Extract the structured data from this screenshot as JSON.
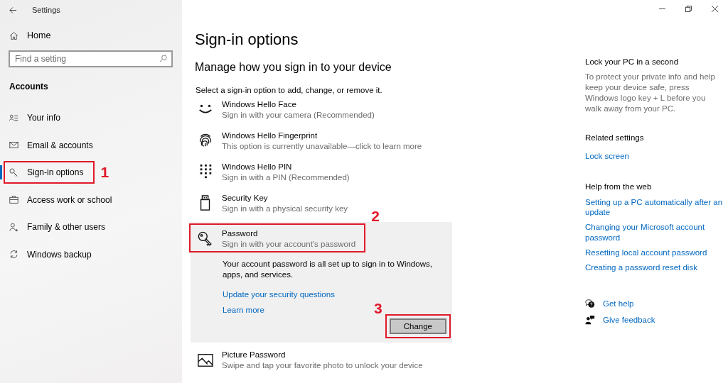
{
  "window": {
    "title": "Settings"
  },
  "sidebar": {
    "home": "Home",
    "search": {
      "placeholder": "Find a setting"
    },
    "section": "Accounts",
    "items": [
      {
        "label": "Your info",
        "kind": "person-list",
        "selected": false
      },
      {
        "label": "Email & accounts",
        "kind": "mail",
        "selected": false
      },
      {
        "label": "Sign-in options",
        "kind": "key",
        "selected": true,
        "callout": "1"
      },
      {
        "label": "Access work or school",
        "kind": "briefcase",
        "selected": false
      },
      {
        "label": "Family & other users",
        "kind": "person-add",
        "selected": false
      },
      {
        "label": "Windows backup",
        "kind": "sync",
        "selected": false
      }
    ]
  },
  "main": {
    "title": "Sign-in options",
    "subtitle": "Manage how you sign in to your device",
    "intro": "Select a sign-in option to add, change, or remove it.",
    "options": [
      {
        "kind": "face",
        "title": "Windows Hello Face",
        "subtitle": "Sign in with your camera (Recommended)",
        "expanded": false
      },
      {
        "kind": "fingerprint",
        "title": "Windows Hello Fingerprint",
        "subtitle": "This option is currently unavailable—click to learn more",
        "expanded": false
      },
      {
        "kind": "pin",
        "title": "Windows Hello PIN",
        "subtitle": "Sign in with a PIN (Recommended)",
        "expanded": false
      },
      {
        "kind": "usb",
        "title": "Security Key",
        "subtitle": "Sign in with a physical security key",
        "expanded": false
      },
      {
        "kind": "key",
        "title": "Password",
        "subtitle": "Sign in with your account's password",
        "expanded": true,
        "callout": "2",
        "details": "Your account password is all set up to sign in to Windows, apps, and services.",
        "links": [
          "Update your security questions",
          "Learn more"
        ],
        "button": {
          "label": "Change",
          "callout": "3"
        }
      },
      {
        "kind": "picture",
        "title": "Picture Password",
        "subtitle": "Swipe and tap your favorite photo to unlock your device",
        "expanded": false
      }
    ]
  },
  "aside": {
    "lock": {
      "title": "Lock your PC in a second",
      "text": "To protect your private info and help keep your device safe, press Windows logo key + L before you walk away from your PC."
    },
    "related": {
      "title": "Related settings",
      "links": [
        "Lock screen"
      ]
    },
    "help": {
      "title": "Help from the web",
      "links": [
        "Setting up a PC automatically after an update",
        "Changing your Microsoft account password",
        "Resetting local account password",
        "Creating a password reset disk"
      ]
    },
    "actions": [
      {
        "kind": "help",
        "label": "Get help"
      },
      {
        "kind": "feedback",
        "label": "Give feedback"
      }
    ]
  }
}
